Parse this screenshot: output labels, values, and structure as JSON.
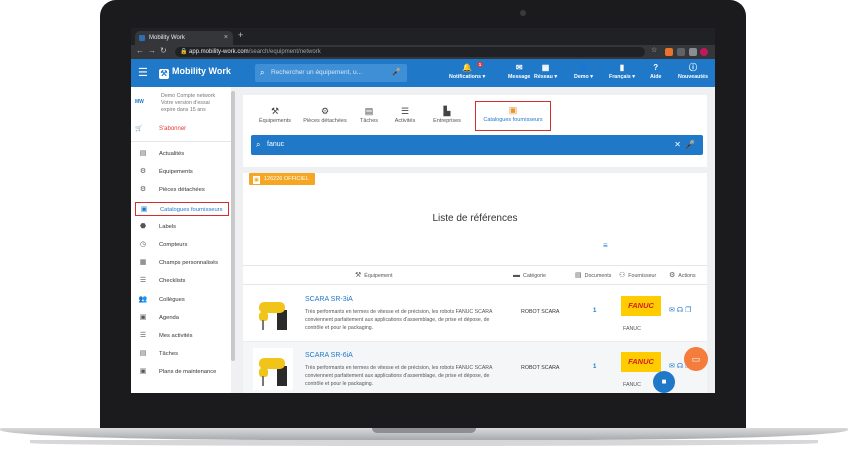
{
  "browser": {
    "tab_title": "Mobility Work",
    "tab_close": "×",
    "new_tab": "+",
    "url_host": "app.mobility-work.com",
    "url_path": "/search/equipment/network"
  },
  "header": {
    "logo_text": "Mobility Work",
    "search_placeholder": "Rechercher un équipement, u...",
    "items": [
      {
        "label": "Notifications ▾",
        "icon": "bell-icon",
        "glyph": "🔔",
        "badge": "1"
      },
      {
        "label": "Message",
        "icon": "message-icon",
        "glyph": "✉"
      },
      {
        "label": "Réseau ▾",
        "icon": "network-icon",
        "glyph": "▦"
      },
      {
        "label": "Demo ▾",
        "icon": "user-icon",
        "glyph": "👤"
      },
      {
        "label": "Français ▾",
        "icon": "flag-icon",
        "glyph": "▮"
      },
      {
        "label": "Aide",
        "icon": "help-icon",
        "glyph": "?"
      },
      {
        "label": "Nouveautés",
        "icon": "info-icon",
        "glyph": "ⓘ"
      }
    ]
  },
  "sidebar": {
    "demo_logo": "MW",
    "demo_lines": [
      "Demo Compte network",
      "Votre version d'essai",
      "expire dans 15 ans"
    ],
    "subscribe": "S'abonner",
    "items": [
      {
        "label": "Actualités",
        "icon": "news-icon",
        "glyph": "▤"
      },
      {
        "label": "Équipements",
        "icon": "equipment-icon",
        "glyph": "⚙"
      },
      {
        "label": "Pièces détachées",
        "icon": "parts-icon",
        "glyph": "⚙"
      },
      {
        "label": "Catalogues fournisseurs",
        "icon": "catalog-icon",
        "glyph": "▣",
        "active": true
      },
      {
        "label": "Labels",
        "icon": "label-icon",
        "glyph": "⬣"
      },
      {
        "label": "Compteurs",
        "icon": "counter-icon",
        "glyph": "◷"
      },
      {
        "label": "Champs personnalisés",
        "icon": "fields-icon",
        "glyph": "▦"
      },
      {
        "label": "Checklists",
        "icon": "checklist-icon",
        "glyph": "☰"
      },
      {
        "label": "Collègues",
        "icon": "colleagues-icon",
        "glyph": "👥"
      },
      {
        "label": "Agenda",
        "icon": "calendar-icon",
        "glyph": "▣"
      },
      {
        "label": "Mes activités",
        "icon": "activities-icon",
        "glyph": "☰"
      },
      {
        "label": "Tâches",
        "icon": "tasks-icon",
        "glyph": "▤"
      },
      {
        "label": "Plans de maintenance",
        "icon": "plans-icon",
        "glyph": "▣"
      }
    ]
  },
  "categories": [
    {
      "label": "Équipements",
      "icon": "robot-arm-icon",
      "glyph": "⚒"
    },
    {
      "label": "Pièces détachées",
      "icon": "gears-icon",
      "glyph": "⚙"
    },
    {
      "label": "Tâches",
      "icon": "clipboard-icon",
      "glyph": "▤"
    },
    {
      "label": "Activités",
      "icon": "list-icon",
      "glyph": "☰"
    },
    {
      "label": "Entreprises",
      "icon": "factory-icon",
      "glyph": "▙"
    },
    {
      "label": "Catalogues fournisseurs",
      "icon": "catalog-icon",
      "glyph": "▣",
      "active": true
    }
  ],
  "search": {
    "value": "fanuc"
  },
  "official_badge": "126226 OFFICIEL",
  "list_title": "Liste de références",
  "table": {
    "headers": {
      "equipment": "Équipement",
      "category": "Catégorie",
      "documents": "Documents",
      "supplier": "Fournisseur",
      "actions": "Actions"
    },
    "rows": [
      {
        "title": "SCARA SR-3iA",
        "description": "Très performants en termes de  vitesse et de précision, les robots FANUC SCARA conviennent parfaitement aux applications d'assemblage, de prise et dépose, de contrôle et pour le packaging.",
        "category": "ROBOT SCARA",
        "documents": "1",
        "supplier_logo": "FANUC",
        "supplier": "FANUC"
      },
      {
        "title": "SCARA SR-6iA",
        "description": "Très performants en termes de  vitesse et de précision, les robots FANUC SCARA conviennent parfaitement aux applications d'assemblage, de prise et dépose, de contrôle et pour le packaging.",
        "category": "ROBOT SCARA",
        "documents": "1",
        "supplier_logo": "FANUC",
        "supplier": "FANUC"
      }
    ]
  },
  "colors": {
    "brand_blue": "#1f78c8",
    "accent_orange": "#f5a623",
    "highlight_red": "#d62d2d",
    "chat_orange": "#f47c3c"
  }
}
